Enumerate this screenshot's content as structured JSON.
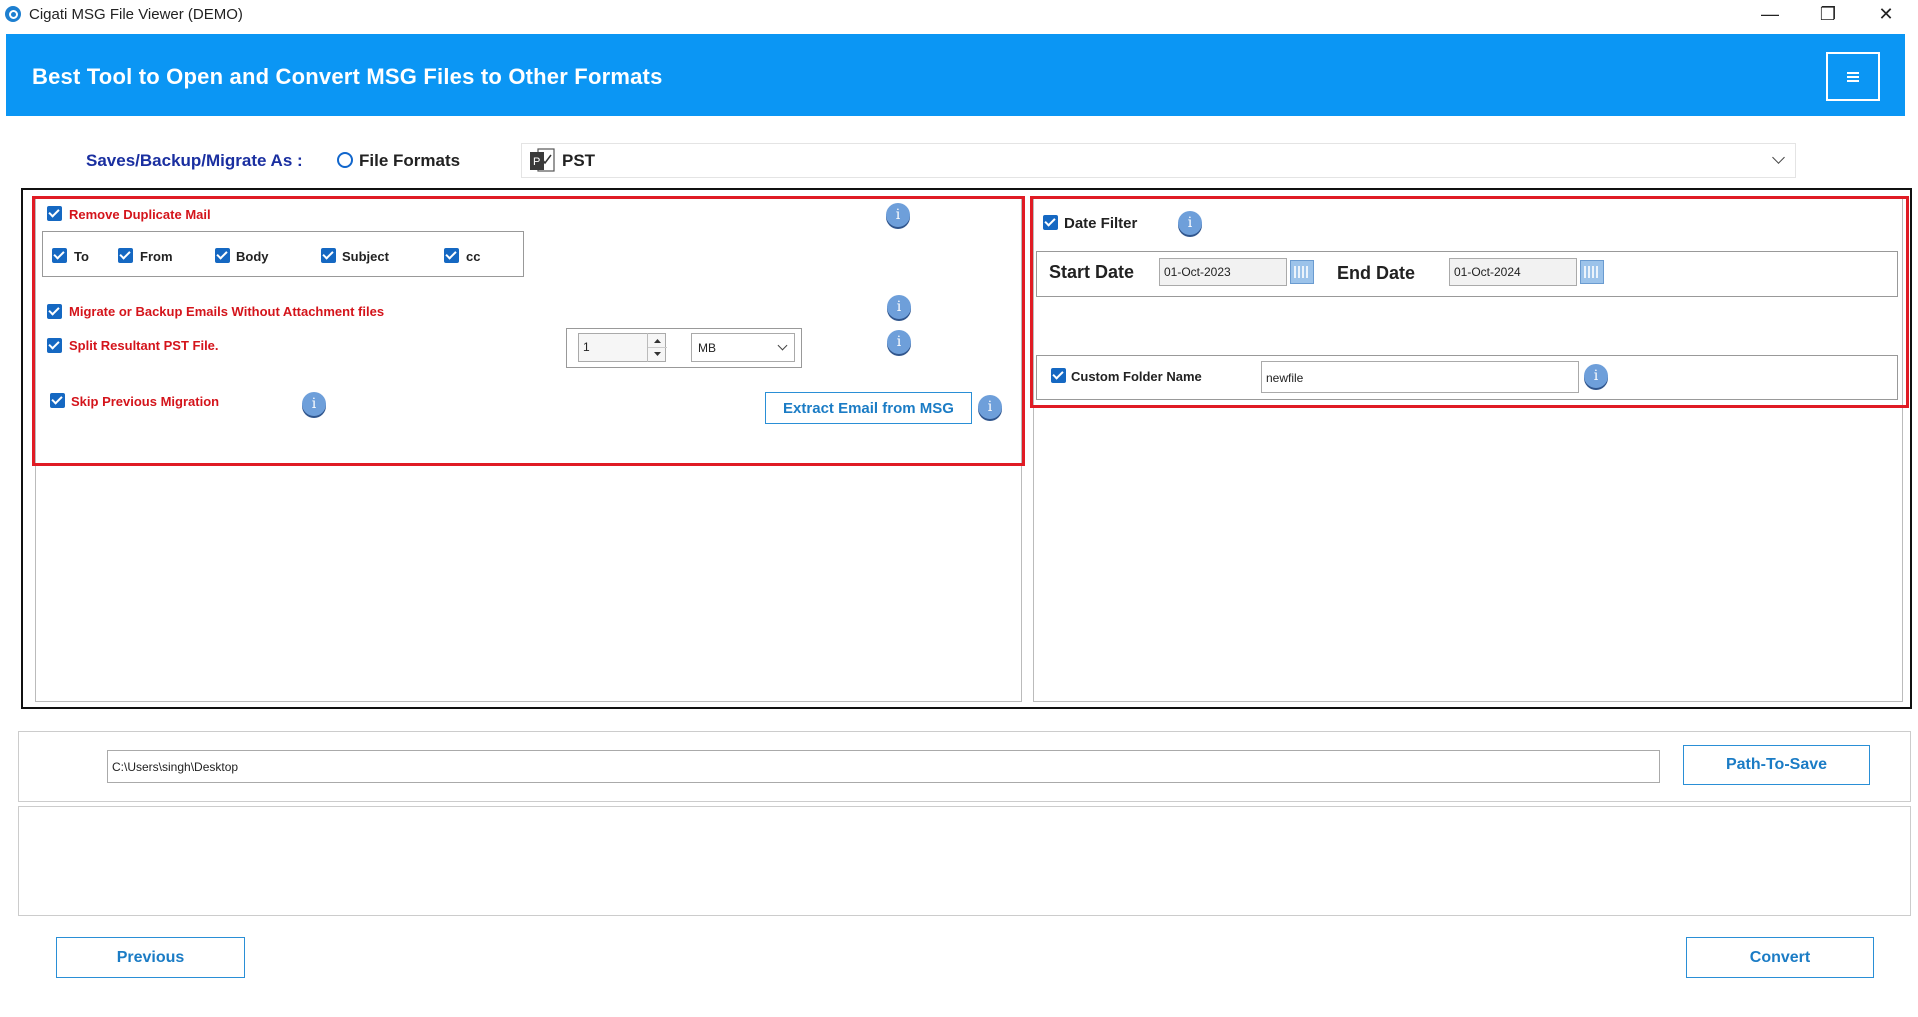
{
  "window": {
    "title": "Cigati MSG File Viewer (DEMO)",
    "controls": {
      "minimize": "—",
      "restore": "❐",
      "close": "✕"
    }
  },
  "header": {
    "title": "Best Tool to Open and Convert MSG Files to Other Formats",
    "menu_icon": "hamburger-icon"
  },
  "saveas": {
    "label": "Saves/Backup/Migrate As :",
    "radio_label": "File Formats",
    "selected_format": "PST"
  },
  "left_options": {
    "remove_duplicate": "Remove Duplicate Mail",
    "duplicate_fields": [
      "To",
      "From",
      "Body",
      "Subject",
      "cc"
    ],
    "without_attachment": "Migrate or Backup Emails Without Attachment files",
    "split_pst": "Split Resultant PST File.",
    "split_value": "1",
    "split_unit": "MB",
    "skip_previous": "Skip Previous Migration",
    "extract_button": "Extract Email from MSG",
    "info_glyph": "i"
  },
  "right_options": {
    "date_filter": "Date Filter",
    "start_label": "Start Date",
    "start_value": "01-Oct-2023",
    "end_label": "End Date",
    "end_value": "01-Oct-2024",
    "custom_folder": "Custom Folder Name",
    "custom_folder_value": "newfile"
  },
  "path": {
    "value": "C:\\Users\\singh\\Desktop",
    "button": "Path-To-Save"
  },
  "footer": {
    "previous": "Previous",
    "convert": "Convert"
  },
  "colors": {
    "accent": "#0b96f4",
    "highlight": "#e01b24",
    "checkbox": "#1568c2",
    "button_text": "#1b7cc5"
  }
}
